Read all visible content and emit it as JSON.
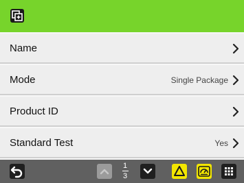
{
  "header": {
    "icon": "copy-icon"
  },
  "menu": {
    "items": [
      {
        "label": "Name",
        "value": ""
      },
      {
        "label": "Mode",
        "value": "Single Package"
      },
      {
        "label": "Product ID",
        "value": ""
      },
      {
        "label": "Standard Test",
        "value": "Yes"
      }
    ]
  },
  "footer": {
    "page_current": "1",
    "page_total": "3",
    "icons": [
      "back-icon",
      "chevron-up-icon",
      "chevron-down-icon",
      "warning-icon",
      "gauge-icon",
      "grid-icon"
    ]
  },
  "colors": {
    "header_bg": "#77d42b",
    "footer_bg": "#606060",
    "row_bg": "#eeeeee",
    "alert_yellow": "#f2e600",
    "dark_button": "#1f1f1f"
  }
}
